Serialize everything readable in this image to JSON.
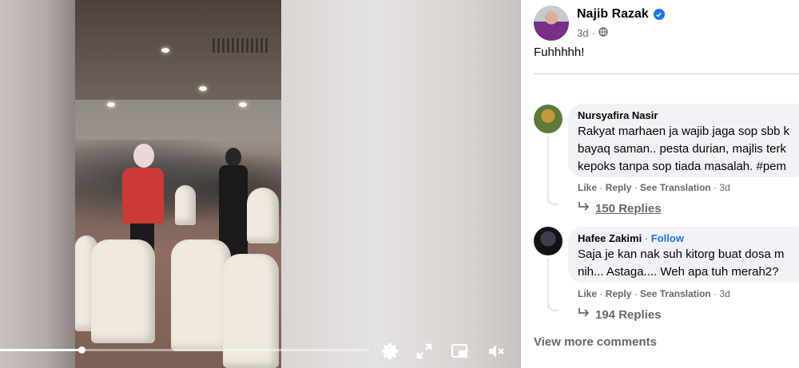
{
  "video": {
    "progress_percent": 22,
    "controls": {
      "settings_icon": "gear-icon",
      "fullscreen_icon": "expand-icon",
      "pip_icon": "picture-in-picture-icon",
      "volume_icon": "muted-speaker-icon"
    }
  },
  "post": {
    "author": "Najib Razak",
    "verified": true,
    "time": "3d",
    "separator": "·",
    "audience_icon": "globe-icon",
    "text": "Fuhhhhh!"
  },
  "comments": [
    {
      "name": "Nursyafira Nasir",
      "follow": "",
      "lines": [
        "Rakyat marhaen ja wajib jaga sop sbb k",
        "bayaq saman.. pesta durian, majlis terk",
        "kepoks tanpa sop tiada masalah. #pem"
      ],
      "actions": {
        "like": "Like",
        "reply": "Reply",
        "translate": "See Translation",
        "time": "3d"
      },
      "replies": "150 Replies"
    },
    {
      "name": "Hafee Zakimi",
      "follow": "Follow",
      "lines": [
        "Saja je kan nak suh kitorg buat dosa m",
        "nih... Astaga.... Weh apa tuh merah2?"
      ],
      "actions": {
        "like": "Like",
        "reply": "Reply",
        "translate": "See Translation",
        "time": "3d"
      },
      "replies": "194 Replies"
    }
  ],
  "view_more": "View more comments",
  "colors": {
    "accent": "#1877f2",
    "muted": "#65676b",
    "bubble": "#f0f2f5"
  }
}
